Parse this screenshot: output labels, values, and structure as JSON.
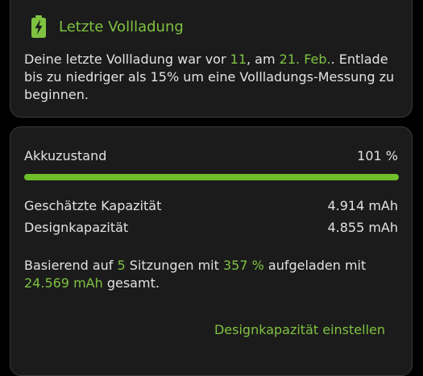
{
  "last_charge_card": {
    "title": "Letzte Vollladung",
    "icon": "battery-charging-icon",
    "text": {
      "p1": "Deine letzte Vollladung war vor ",
      "days": "11",
      "p2": ", am ",
      "date": "21. Feb.",
      "p3": ". Entlade bis zu niedriger als 15% um eine Vollladungs-Messung zu beginnen."
    }
  },
  "health_card": {
    "health_label": "Akkuzustand",
    "health_value": "101 %",
    "health_fraction": 1.0,
    "estimated_capacity_label": "Geschätzte Kapazität",
    "estimated_capacity_value": "4.914 mAh",
    "design_capacity_label": "Designkapazität",
    "design_capacity_value": "4.855 mAh",
    "summary": {
      "p1": "Basierend auf ",
      "sessions": "5",
      "p2": " Sitzungen mit ",
      "percent": "357 %",
      "p3": " aufgeladen mit ",
      "total": "24.569 mAh",
      "p4": " gesamt."
    },
    "action_label": "Designkapazität einstellen"
  },
  "colors": {
    "accent": "#7fc241",
    "progress": "#6fbf2a",
    "card_background": "#1b1b1b",
    "card_border": "#3a3a3a",
    "page_background": "#000000"
  }
}
